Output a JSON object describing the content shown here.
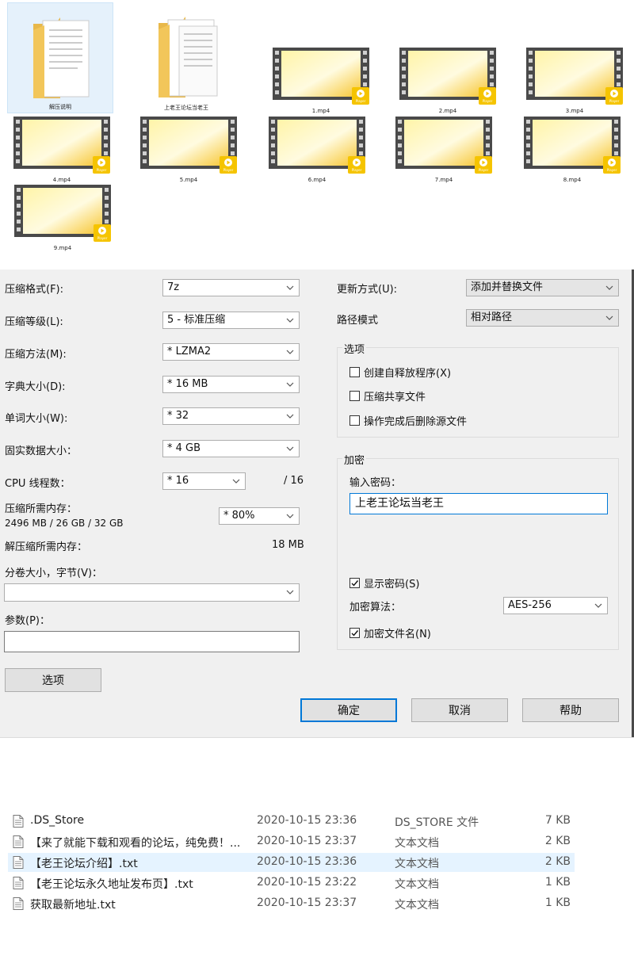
{
  "files_grid": [
    {
      "name": "解压说明",
      "kind": "folder",
      "selected": true
    },
    {
      "name": "上老王论坛当老王",
      "kind": "folder",
      "selected": false
    },
    {
      "name": "1.mp4",
      "kind": "video"
    },
    {
      "name": "2.mp4",
      "kind": "video"
    },
    {
      "name": "3.mp4",
      "kind": "video"
    },
    {
      "name": "4.mp4",
      "kind": "video"
    },
    {
      "name": "5.mp4",
      "kind": "video"
    },
    {
      "name": "6.mp4",
      "kind": "video"
    },
    {
      "name": "7.mp4",
      "kind": "video"
    },
    {
      "name": "8.mp4",
      "kind": "video"
    },
    {
      "name": "9.mp4",
      "kind": "video"
    }
  ],
  "video_badge": "Player",
  "dialog": {
    "format_label": "压缩格式(F):",
    "format_value": "7z",
    "level_label": "压缩等级(L):",
    "level_value": "5 - 标准压缩",
    "method_label": "压缩方法(M):",
    "method_value": "* LZMA2",
    "dict_label": "字典大小(D):",
    "dict_value": "* 16 MB",
    "word_label": "单词大小(W):",
    "word_value": "* 32",
    "solid_label": "固实数据大小：",
    "solid_value": "* 4 GB",
    "cpu_label": "CPU 线程数：",
    "cpu_value": "* 16",
    "cpu_max": "/ 16",
    "mem_comp_label": "压缩所需内存：",
    "mem_comp_detail": "2496 MB / 26 GB / 32 GB",
    "mem_comp_value": "* 80%",
    "mem_decomp_label": "解压缩所需内存：",
    "mem_decomp_value": "18 MB",
    "split_label": "分卷大小，字节(V)：",
    "split_value": "",
    "params_label": "参数(P)：",
    "params_value": "",
    "options_button": "选项",
    "update_label": "更新方式(U):",
    "update_value": "添加并替换文件",
    "path_label": "路径模式",
    "path_value": "相对路径",
    "options_group": "选项",
    "opt_sfx": "创建自释放程序(X)",
    "opt_sfx_checked": false,
    "opt_shared": "压缩共享文件",
    "opt_shared_checked": false,
    "opt_delete": "操作完成后删除源文件",
    "opt_delete_checked": false,
    "encrypt_group": "加密",
    "password_label": "输入密码：",
    "password_value": "上老王论坛当老王",
    "show_password": "显示密码(S)",
    "show_password_checked": true,
    "algo_label": "加密算法：",
    "algo_value": "AES-256",
    "encrypt_names": "加密文件名(N)",
    "encrypt_names_checked": true,
    "ok": "确定",
    "cancel": "取消",
    "help": "帮助",
    "colors": {
      "accent": "#0078d7",
      "face": "#f0f0f0"
    }
  },
  "file_list": [
    {
      "name": ".DS_Store",
      "date": "2020-10-15 23:36",
      "type": "DS_STORE 文件",
      "size": "7 KB"
    },
    {
      "name": "【来了就能下载和观看的论坛，纯免费！...",
      "date": "2020-10-15 23:37",
      "type": "文本文档",
      "size": "2 KB"
    },
    {
      "name": "【老王论坛介绍】.txt",
      "date": "2020-10-15 23:36",
      "type": "文本文档",
      "size": "2 KB",
      "highlight": true
    },
    {
      "name": "【老王论坛永久地址发布页】.txt",
      "date": "2020-10-15 23:22",
      "type": "文本文档",
      "size": "1 KB"
    },
    {
      "name": "获取最新地址.txt",
      "date": "2020-10-15 23:37",
      "type": "文本文档",
      "size": "1 KB"
    }
  ]
}
